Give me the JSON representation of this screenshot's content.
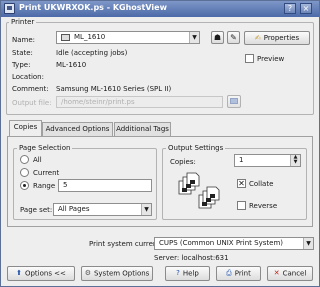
{
  "window": {
    "title": "Print UKWRXOK.ps - KGhostView"
  },
  "printer": {
    "group_label": "Printer",
    "name_label": "Name:",
    "name_value": "ML_1610",
    "properties_label": "Properties",
    "preview_label": "Preview",
    "state_label": "State:",
    "state_value": "Idle (accepting jobs)",
    "type_label": "Type:",
    "type_value": "ML-1610",
    "location_label": "Location:",
    "location_value": "",
    "comment_label": "Comment:",
    "comment_value": "Samsung ML-1610 Series (SPL II)",
    "output_file_label": "Output file:",
    "output_file_value": "/home/steinr/print.ps"
  },
  "tabs": [
    {
      "label": "Copies",
      "active": true
    },
    {
      "label": "Advanced Options",
      "active": false
    },
    {
      "label": "Additional Tags",
      "active": false
    }
  ],
  "page_selection": {
    "group_label": "Page Selection",
    "all_label": "All",
    "current_label": "Current",
    "range_label": "Range",
    "range_value": "5",
    "selected": "range",
    "page_set_label": "Page set:",
    "page_set_value": "All Pages"
  },
  "output_settings": {
    "group_label": "Output Settings",
    "copies_label": "Copies:",
    "copies_value": "1",
    "collate_label": "Collate",
    "collate_checked": true,
    "reverse_label": "Reverse",
    "reverse_checked": false
  },
  "print_system": {
    "label": "Print system currently used:",
    "value": "CUPS (Common UNIX Print System)",
    "server": "Server: localhost:631"
  },
  "buttons": {
    "options_label": "Options <<",
    "system_options_label": "System Options",
    "help_label": "Help",
    "print_label": "Print",
    "cancel_label": "Cancel"
  },
  "colors": {
    "title_bar": "#5a76b0",
    "print_icon": "#2e5fb8",
    "cancel_icon": "#c0261b"
  }
}
